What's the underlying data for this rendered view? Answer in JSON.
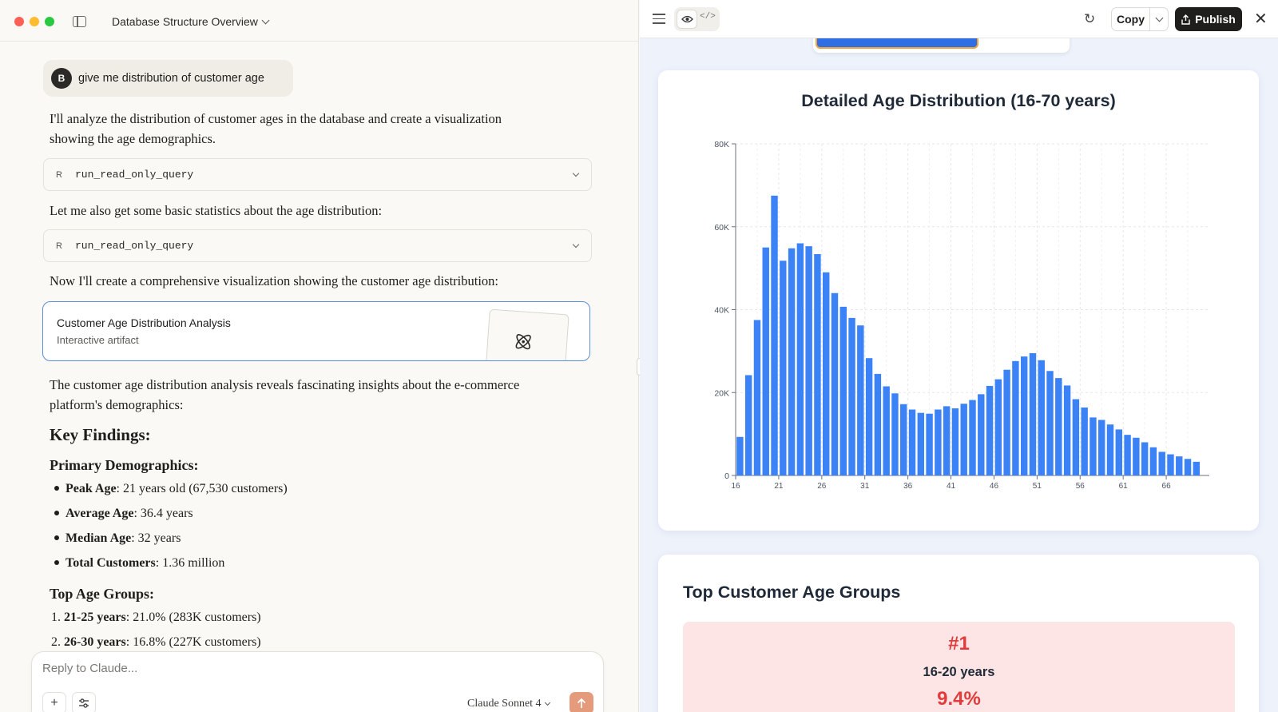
{
  "window": {
    "conversation_title": "Database Structure Overview"
  },
  "chat": {
    "user_avatar": "B",
    "user_message": "give me distribution of customer age",
    "para1_line1": "I'll analyze the distribution of customer ages in the database and create a visualization",
    "para1_line2": "showing the age demographics.",
    "tool1": {
      "badge": "R",
      "name": "run_read_only_query"
    },
    "para2": "Let me also get some basic statistics about the age distribution:",
    "tool2": {
      "badge": "R",
      "name": "run_read_only_query"
    },
    "para3": "Now I'll create a comprehensive visualization showing the customer age distribution:",
    "artifact": {
      "title": "Customer Age Distribution Analysis",
      "subtitle": "Interactive artifact",
      "icon": "atom-icon"
    },
    "para4_line1": "The customer age distribution analysis reveals fascinating insights about the e-commerce",
    "para4_line2": "platform's demographics:",
    "key_findings": "Key Findings:",
    "primary_demographics": "Primary Demographics:",
    "bullets": [
      {
        "label": "Peak Age",
        "text": ": 21 years old (67,530 customers)"
      },
      {
        "label": "Average Age",
        "text": ": 36.4 years"
      },
      {
        "label": "Median Age",
        "text": ": 32 years"
      },
      {
        "label": "Total Customers",
        "text": ": 1.36 million"
      }
    ],
    "top_age_groups": "Top Age Groups:",
    "numbered": [
      {
        "num": "1.",
        "label": "21-25 years",
        "text": ": 21.0% (283K customers)"
      },
      {
        "num": "2.",
        "label": "26-30 years",
        "text": ": 16.8% (227K customers)"
      }
    ]
  },
  "composer": {
    "placeholder": "Reply to Claude...",
    "add_icon": "plus-icon",
    "tools_icon": "sliders-icon",
    "model": "Claude Sonnet 4",
    "send_icon": "arrow-up-icon"
  },
  "artifact_toolbar": {
    "copy_label": "Copy",
    "publish_label": "Publish"
  },
  "chart_data": {
    "type": "bar",
    "title": "Detailed Age Distribution (16-70 years)",
    "xlabel": "",
    "ylabel": "",
    "ylim": [
      0,
      80000
    ],
    "yticks": [
      0,
      20000,
      40000,
      60000,
      80000
    ],
    "ytick_labels": [
      "0",
      "20K",
      "40K",
      "60K",
      "80K"
    ],
    "xtick_labels": [
      "16",
      "21",
      "26",
      "31",
      "36",
      "41",
      "46",
      "51",
      "56",
      "61",
      "66"
    ],
    "grid": true,
    "bar_color": "#3b82f6",
    "x": [
      17,
      18,
      19,
      20,
      21,
      22,
      23,
      24,
      25,
      26,
      27,
      28,
      29,
      30,
      31,
      32,
      33,
      34,
      35,
      36,
      37,
      38,
      39,
      40,
      41,
      42,
      43,
      44,
      45,
      46,
      47,
      48,
      49,
      50,
      51,
      52,
      53,
      54,
      55,
      56,
      57,
      58,
      59,
      60,
      61,
      62,
      63,
      64,
      65,
      66,
      67,
      68,
      69,
      70
    ],
    "values": [
      9300,
      24200,
      37500,
      55000,
      67500,
      51800,
      54800,
      56000,
      55300,
      53400,
      49000,
      44000,
      40700,
      38000,
      36200,
      28300,
      24500,
      21500,
      19800,
      17200,
      15900,
      15100,
      14900,
      15900,
      16700,
      16200,
      17300,
      18200,
      19600,
      21600,
      23200,
      25500,
      27600,
      28700,
      29500,
      27800,
      25200,
      23500,
      21700,
      18400,
      16400,
      14000,
      13400,
      12300,
      11100,
      9800,
      9100,
      8000,
      6800,
      5700,
      5100,
      4600,
      4000,
      3300
    ]
  },
  "top_groups": {
    "title": "Top Customer Age Groups",
    "first": {
      "rank": "#1",
      "range": "16-20 years",
      "pct": "9.4%"
    }
  }
}
